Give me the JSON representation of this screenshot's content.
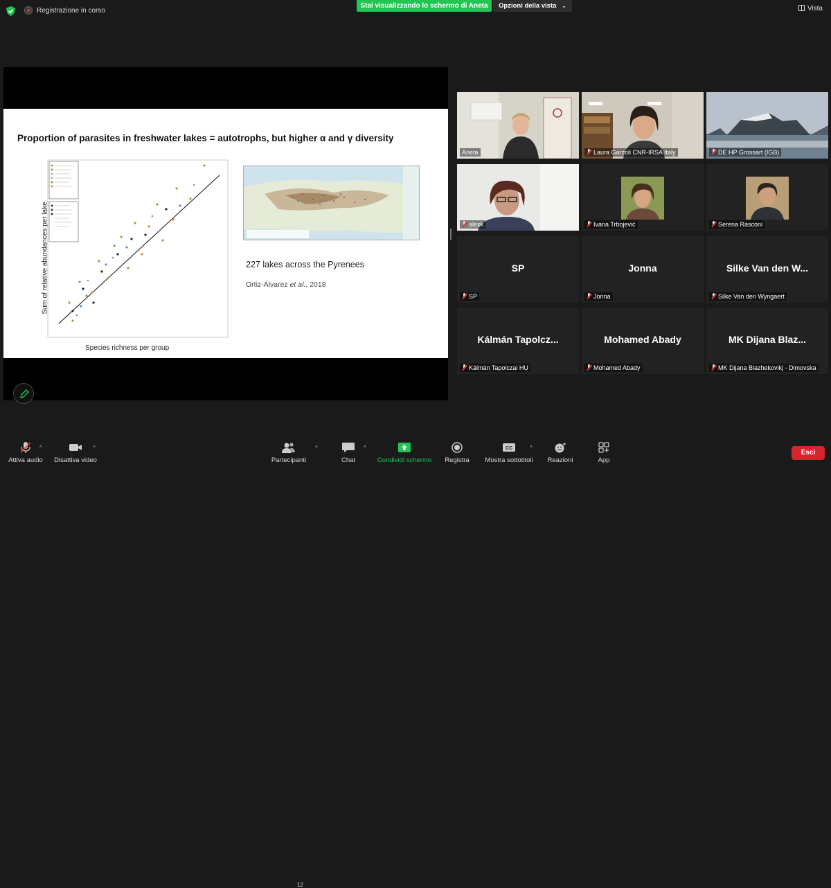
{
  "topbar": {
    "recording_text": "Registrazione in corso",
    "share_banner": "Stai visualizzando lo schermo di Aneta",
    "view_options": "Opzioni della vista",
    "view_button": "Vista"
  },
  "slide": {
    "title": "Proportion of parasites in freshwater lakes = autotrophs, but higher α and γ diversity",
    "y_axis_label": "Sum of relative abundances per lake",
    "x_axis_label": "Species richness per group",
    "map_caption": "227 lakes across the Pyrenees",
    "citation_prefix": "Ortiz-Álvarez ",
    "citation_etal": "et al.",
    "citation_suffix": ", 2018"
  },
  "participants": [
    {
      "display": "",
      "label": "Aneta",
      "active": true
    },
    {
      "display": "",
      "label": "Laura Garzoli CNR-IRSA Italy"
    },
    {
      "display": "",
      "label": "DE HP Grossart (IGB)"
    },
    {
      "display": "",
      "label": "alexk"
    },
    {
      "display": "",
      "label": "Ivana Trbojević"
    },
    {
      "display": "",
      "label": "Serena Rasconi"
    },
    {
      "display": "SP",
      "label": "SP"
    },
    {
      "display": "Jonna",
      "label": "Jonna"
    },
    {
      "display": "Silke Van den W...",
      "label": "Silke Van den Wyngaert"
    },
    {
      "display": "Kálmán  Tapolcz...",
      "label": "Kálmán Tapolczai HU"
    },
    {
      "display": "Mohamed Abady",
      "label": "Mohamed Abady"
    },
    {
      "display": "MK Dijana  Blaz...",
      "label": "MK Dijana Blazhekovikj - Dimovska"
    }
  ],
  "toolbar": {
    "audio": "Attiva audio",
    "video": "Disattiva video",
    "participants": "Partecipanti",
    "participants_count": "12",
    "chat": "Chat",
    "share": "Condividi schermo",
    "record": "Registra",
    "captions": "Mostra sottotitoli",
    "reactions": "Reazioni",
    "apps": "App",
    "exit": "Esci"
  },
  "colors": {
    "share_green": "#23c552",
    "exit_red": "#d4242c",
    "active_speaker": "#c6e07a"
  }
}
